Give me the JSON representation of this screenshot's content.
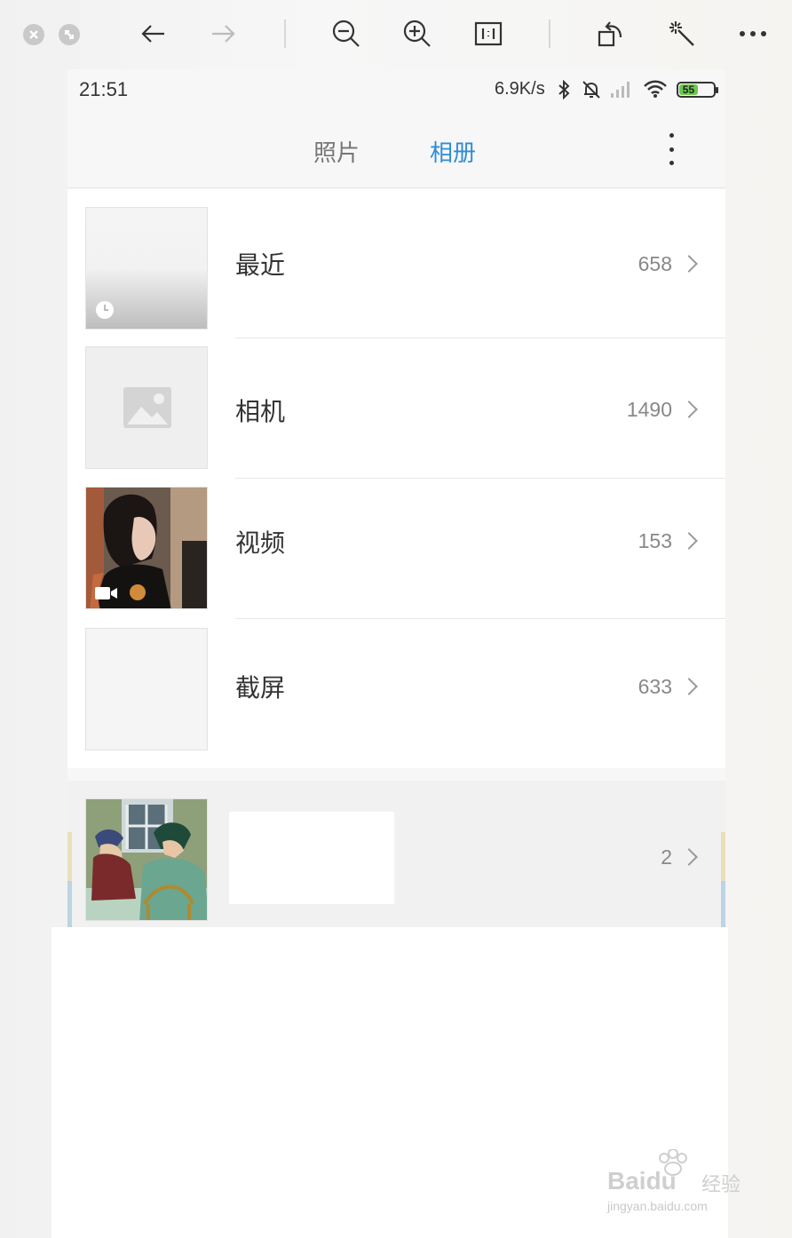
{
  "viewer": {
    "buttons": [
      "close",
      "minimize",
      "back",
      "forward",
      "zoom-out",
      "zoom-in",
      "actual-size",
      "rotate",
      "enhance",
      "more"
    ]
  },
  "status_bar": {
    "time": "21:51",
    "net_speed": "6.9K/s",
    "battery": "55"
  },
  "header": {
    "tabs": [
      {
        "label": "照片",
        "active": false
      },
      {
        "label": "相册",
        "active": true
      }
    ]
  },
  "albums": [
    {
      "name": "最近",
      "count": "658",
      "badge": "clock-icon"
    },
    {
      "name": "相机",
      "count": "1490",
      "badge": "image-placeholder-icon"
    },
    {
      "name": "视频",
      "count": "153",
      "badge": "video-icon"
    },
    {
      "name": "截屏",
      "count": "633",
      "badge": ""
    }
  ],
  "extra_album": {
    "name": "",
    "count": "2"
  },
  "watermark": {
    "brand": "Baidu",
    "suffix": "经验",
    "url": "jingyan.baidu.com"
  },
  "colors": {
    "active_tab": "#2f8dd6",
    "battery": "#6bc94d"
  }
}
